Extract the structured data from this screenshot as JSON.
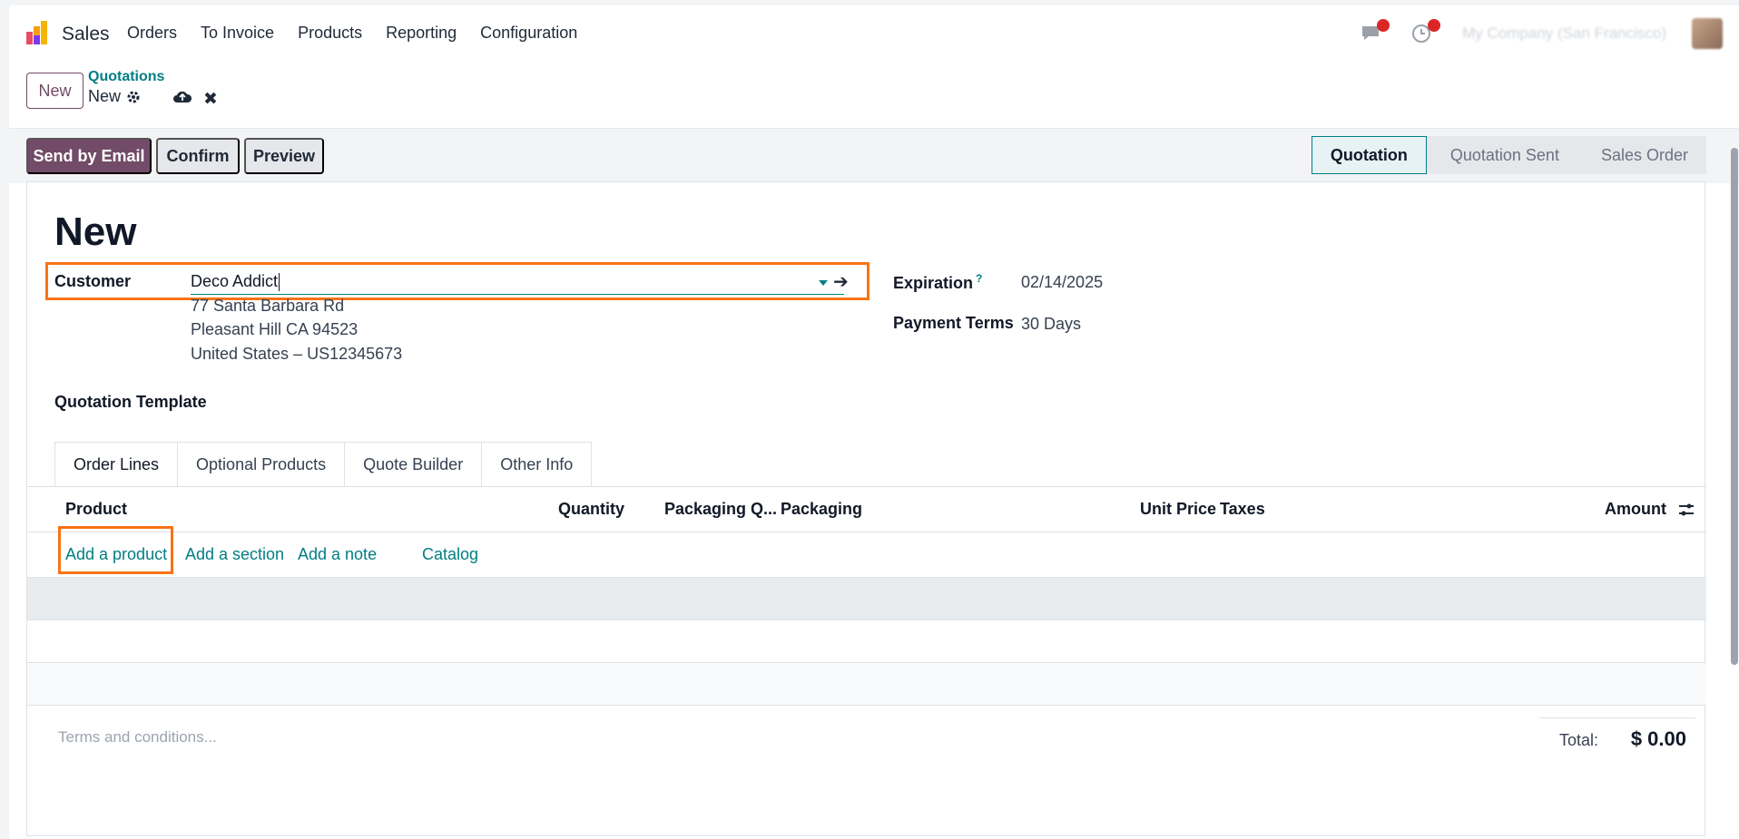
{
  "topnav": {
    "app_name": "Sales",
    "menu": [
      "Orders",
      "To Invoice",
      "Products",
      "Reporting",
      "Configuration"
    ],
    "company": "My Company (San Francisco)"
  },
  "control": {
    "new_label": "New",
    "breadcrumb_parent": "Quotations",
    "breadcrumb_current": "New"
  },
  "statusbar": {
    "buttons": [
      "Send by Email",
      "Confirm",
      "Preview"
    ],
    "stages": [
      "Quotation",
      "Quotation Sent",
      "Sales Order"
    ],
    "active_stage": "Quotation"
  },
  "form": {
    "title": "New",
    "customer_label": "Customer",
    "customer_value": "Deco Addict",
    "address_line1": "77 Santa Barbara Rd",
    "address_line2": "Pleasant Hill CA 94523",
    "address_line3": "United States – US12345673",
    "template_label": "Quotation Template",
    "expiration_label": "Expiration",
    "expiration_help": "?",
    "expiration_value": "02/14/2025",
    "payment_terms_label": "Payment Terms",
    "payment_terms_value": "30 Days"
  },
  "tabs": [
    "Order Lines",
    "Optional Products",
    "Quote Builder",
    "Other Info"
  ],
  "table": {
    "columns": [
      "Product",
      "Quantity",
      "Packaging Q...",
      "Packaging",
      "Unit Price",
      "Taxes",
      "Amount"
    ],
    "add_links": [
      "Add a product",
      "Add a section",
      "Add a note",
      "Catalog"
    ]
  },
  "footer": {
    "terms_placeholder": "Terms and conditions...",
    "total_label": "Total:",
    "total_value": "$ 0.00"
  },
  "colors": {
    "primary": "#714b67",
    "link": "#017e84",
    "highlight": "#f97316"
  }
}
